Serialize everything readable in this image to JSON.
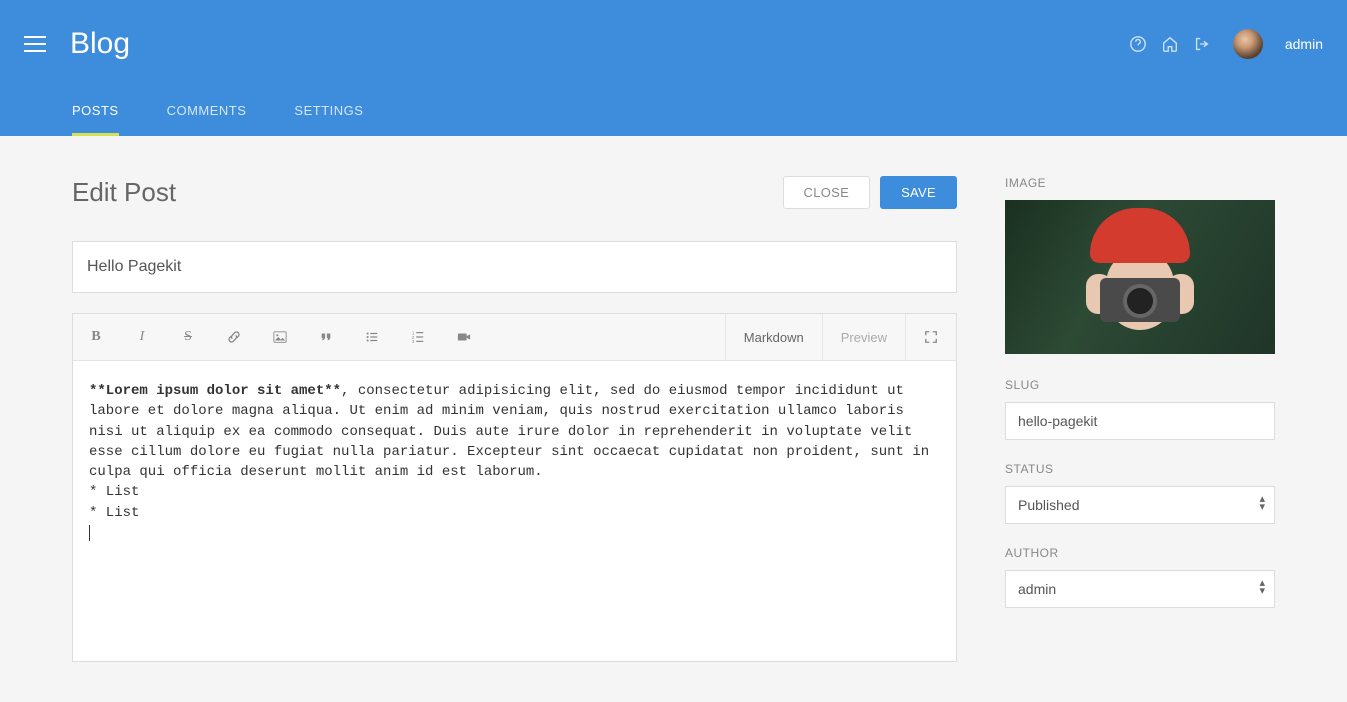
{
  "header": {
    "title": "Blog",
    "username": "admin"
  },
  "tabs": {
    "posts": "POSTS",
    "comments": "COMMENTS",
    "settings": "SETTINGS"
  },
  "page": {
    "title": "Edit Post",
    "close": "CLOSE",
    "save": "SAVE"
  },
  "editor": {
    "titleValue": "Hello Pagekit",
    "modeMarkdown": "Markdown",
    "modePreview": "Preview",
    "bodyBold": "**Lorem ipsum dolor sit amet**",
    "bodyRest": ", consectetur adipisicing elit, sed do eiusmod tempor incididunt ut labore et dolore magna aliqua. Ut enim ad minim veniam, quis nostrud exercitation ullamco laboris nisi ut aliquip ex ea commodo consequat. Duis aute irure dolor in reprehenderit in voluptate velit esse cillum dolore eu fugiat nulla pariatur. Excepteur sint occaecat cupidatat non proident, sunt in culpa qui officia deserunt mollit anim id est laborum.\n* List\n* List\n"
  },
  "sidebar": {
    "imageLabel": "IMAGE",
    "slugLabel": "SLUG",
    "slugValue": "hello-pagekit",
    "statusLabel": "STATUS",
    "statusValue": "Published",
    "authorLabel": "AUTHOR",
    "authorValue": "admin"
  }
}
